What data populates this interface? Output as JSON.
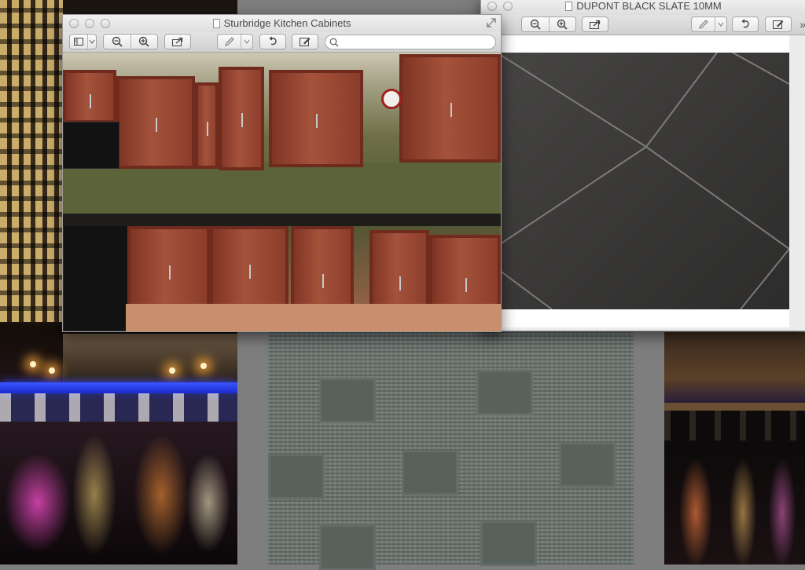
{
  "windows": {
    "kitchen": {
      "title": "Sturbridge Kitchen Cabinets",
      "search_placeholder": "",
      "image_alt": "Sturbridge Kitchen Cabinets"
    },
    "slate": {
      "title": "DUPONT BLACK SLATE 10MM",
      "overflow_label": "»",
      "image_alt": "DUPONT BLACK SLATE 10MM"
    }
  },
  "toolbar_icons": [
    "sidebar-icon",
    "chevron-down-icon",
    "zoom-out-icon",
    "zoom-in-icon",
    "share-icon",
    "pen-icon",
    "chevron-down-icon",
    "rotate-icon",
    "annotate-icon",
    "search-icon"
  ],
  "colors": {
    "chrome": "#ececec",
    "cabinet": "#9a4a33",
    "slate": "#3c3b3a",
    "carpet": "#6f7873"
  }
}
